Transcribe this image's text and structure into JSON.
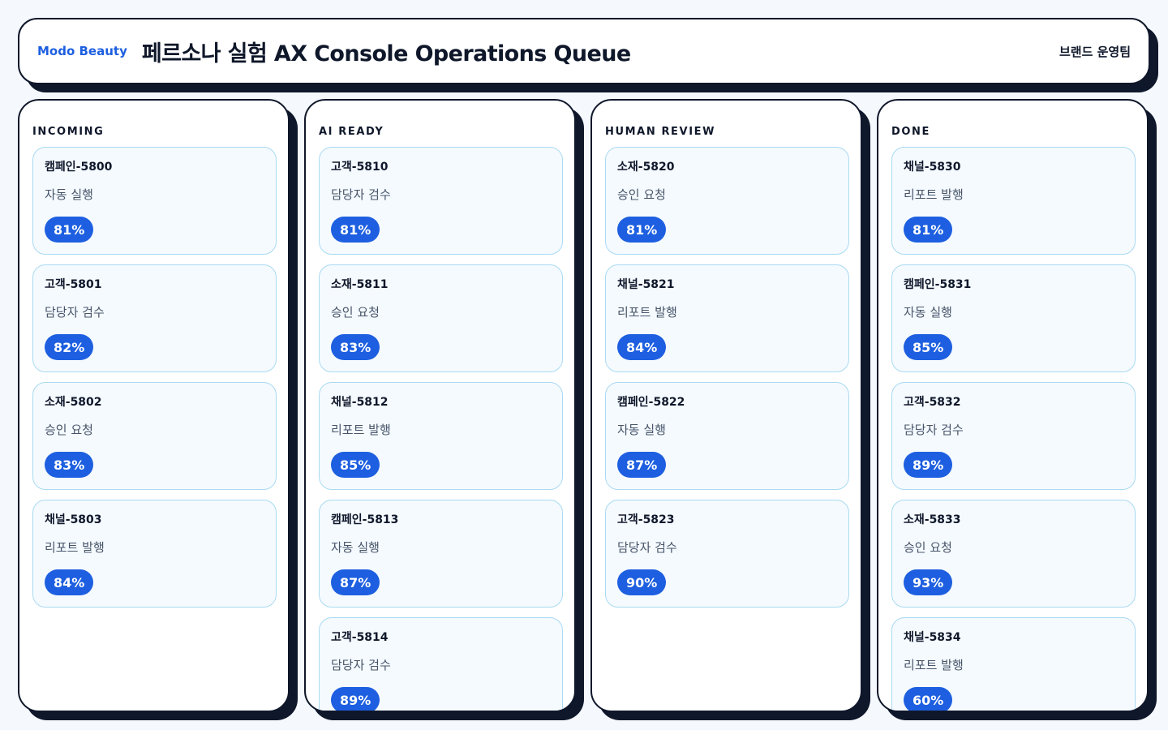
{
  "header": {
    "brand": "Modo Beauty",
    "title": "페르소나 실험 AX Console Operations Queue",
    "team": "브랜드 운영팀"
  },
  "columns": [
    {
      "title": "INCOMING",
      "cards": [
        {
          "id": "캠페인-5800",
          "status": "자동 실행",
          "score": "81%"
        },
        {
          "id": "고객-5801",
          "status": "담당자 검수",
          "score": "82%"
        },
        {
          "id": "소재-5802",
          "status": "승인 요청",
          "score": "83%"
        },
        {
          "id": "채널-5803",
          "status": "리포트 발행",
          "score": "84%"
        }
      ]
    },
    {
      "title": "AI READY",
      "cards": [
        {
          "id": "고객-5810",
          "status": "담당자 검수",
          "score": "81%"
        },
        {
          "id": "소재-5811",
          "status": "승인 요청",
          "score": "83%"
        },
        {
          "id": "채널-5812",
          "status": "리포트 발행",
          "score": "85%"
        },
        {
          "id": "캠페인-5813",
          "status": "자동 실행",
          "score": "87%"
        },
        {
          "id": "고객-5814",
          "status": "담당자 검수",
          "score": "89%"
        }
      ]
    },
    {
      "title": "HUMAN REVIEW",
      "cards": [
        {
          "id": "소재-5820",
          "status": "승인 요청",
          "score": "81%"
        },
        {
          "id": "채널-5821",
          "status": "리포트 발행",
          "score": "84%"
        },
        {
          "id": "캠페인-5822",
          "status": "자동 실행",
          "score": "87%"
        },
        {
          "id": "고객-5823",
          "status": "담당자 검수",
          "score": "90%"
        }
      ]
    },
    {
      "title": "DONE",
      "cards": [
        {
          "id": "채널-5830",
          "status": "리포트 발행",
          "score": "81%"
        },
        {
          "id": "캠페인-5831",
          "status": "자동 실행",
          "score": "85%"
        },
        {
          "id": "고객-5832",
          "status": "담당자 검수",
          "score": "89%"
        },
        {
          "id": "소재-5833",
          "status": "승인 요청",
          "score": "93%"
        },
        {
          "id": "채널-5834",
          "status": "리포트 발행",
          "score": "60%"
        }
      ]
    }
  ],
  "colors": {
    "accent": "#1d5fe0",
    "ink": "#0f172a",
    "card_border": "#a9daf2",
    "card_bg": "#f5faff",
    "page_bg": "#f5f9fe"
  }
}
